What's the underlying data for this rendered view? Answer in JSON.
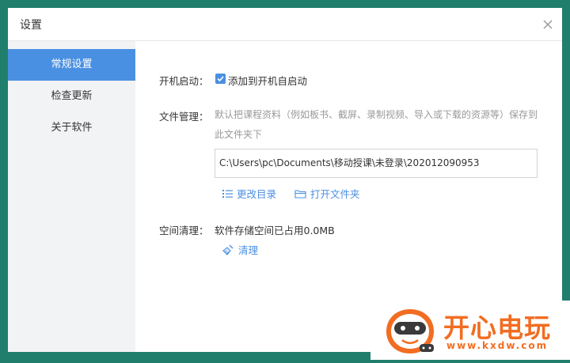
{
  "dialog": {
    "title": "设置"
  },
  "sidebar": {
    "items": [
      {
        "label": "常规设置",
        "active": true
      },
      {
        "label": "检查更新",
        "active": false
      },
      {
        "label": "关于软件",
        "active": false
      }
    ]
  },
  "startup": {
    "label": "开机启动：",
    "checkbox_label": "添加到开机自启动",
    "checked": true
  },
  "file_management": {
    "label": "文件管理：",
    "description": "默认把课程资料（例如板书、截屏、录制视频、导入或下载的资源等）保存到此文件夹下",
    "path": "C:\\Users\\pc\\Documents\\移动授课\\未登录\\202012090953",
    "change_dir_label": "更改目录",
    "open_folder_label": "打开文件夹"
  },
  "cleanup": {
    "label": "空间清理：",
    "storage_text": "软件存储空间已占用0.0MB",
    "clean_label": "清理"
  },
  "watermark": {
    "text": "开心电玩",
    "url": "www.kxdw.com"
  },
  "colors": {
    "accent": "#4a90e2",
    "background": "#1f7e6c",
    "sidebar_bg": "#f2f3f5",
    "watermark": "#f26d21"
  }
}
